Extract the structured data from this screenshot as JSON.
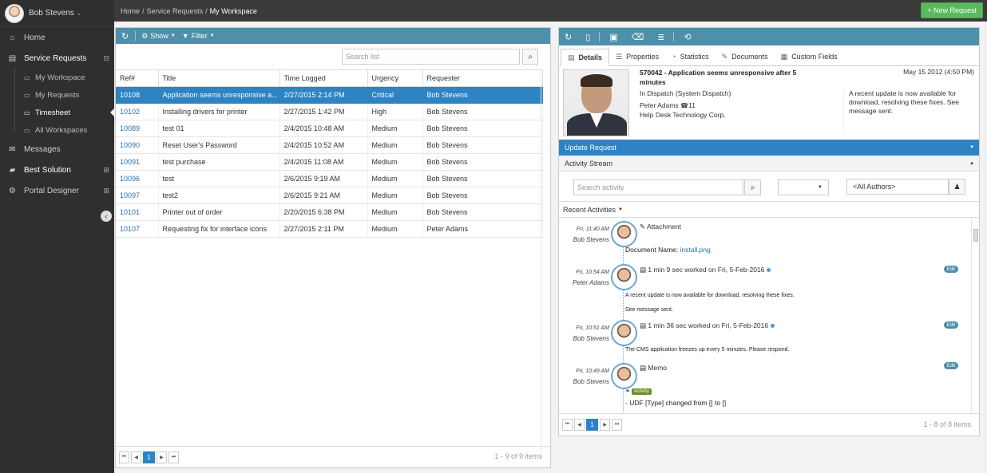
{
  "user": {
    "name": "Bob Stevens"
  },
  "sidebar": {
    "items": [
      {
        "label": "Home",
        "icon": "home-icon"
      },
      {
        "label": "Service Requests",
        "icon": "document-icon"
      },
      {
        "label": "Messages",
        "icon": "envelope-icon"
      },
      {
        "label": "Best Solution",
        "icon": "book-icon"
      },
      {
        "label": "Portal Designer",
        "icon": "gears-icon"
      }
    ],
    "subitems": [
      "My Workspace",
      "My Requests",
      "Timesheet",
      "All Workspaces"
    ]
  },
  "breadcrumb": {
    "home": "Home",
    "section": "Service Requests",
    "current": "My Workspace"
  },
  "new_request_label": "+ New Request",
  "list": {
    "toolbar": {
      "show": "Show",
      "filter": "Filter"
    },
    "search_placeholder": "Search list",
    "columns": [
      "Ref#",
      "Title",
      "Time Logged",
      "Urgency",
      "Requester"
    ],
    "rows": [
      [
        "10108",
        "Application seems unresponsive a...",
        "2/27/2015 2:14 PM",
        "Critical",
        "Bob Stevens"
      ],
      [
        "10102",
        "Installing drivers for printer",
        "2/27/2015 1:42 PM",
        "High",
        "Bob Stevens"
      ],
      [
        "10089",
        "test 01",
        "2/4/2015 10:48 AM",
        "Medium",
        "Bob Stevens"
      ],
      [
        "10090",
        "Reset User's Password",
        "2/4/2015 10:52 AM",
        "Medium",
        "Bob Stevens"
      ],
      [
        "10091",
        "test purchase",
        "2/4/2015 11:08 AM",
        "Medium",
        "Bob Stevens"
      ],
      [
        "10096",
        "test",
        "2/6/2015 9:19 AM",
        "Medium",
        "Bob Stevens"
      ],
      [
        "10097",
        "test2",
        "2/6/2015 9:21 AM",
        "Medium",
        "Bob Stevens"
      ],
      [
        "10101",
        "Printer out of order",
        "2/20/2015 6:38 PM",
        "Medium",
        "Bob Stevens"
      ],
      [
        "10107",
        "Requesting fix for interface icons",
        "2/27/2015 2:11 PM",
        "Medium",
        "Peter Adams"
      ]
    ],
    "page": "1",
    "pager_info": "1 - 9 of 9 items"
  },
  "detail": {
    "tabs": [
      "Details",
      "Properties",
      "Statistics",
      "Documents",
      "Custom Fields"
    ],
    "title": "570042 - Application seems unresponsive after 5 minutes",
    "date": "May 15 2012 (4:50 PM)",
    "status": "In Dispatch (System Dispatch)",
    "person": "Peter Adams",
    "person_count": "11",
    "company": "Help Desk Technology Corp.",
    "note": "A recent update is now available for download, resolving these fixes. See message sent.",
    "update_label": "Update Request",
    "stream_label": "Activity Stream",
    "search_activity_placeholder": "Search activity",
    "authors_value": "<All Authors>",
    "recent_label": "Recent Activities",
    "activities": [
      {
        "time": "Fri, 11:40 AM",
        "user": "Bob Stevens",
        "title": "Attachment",
        "body1": "Document Name: ",
        "link": "install.png"
      },
      {
        "time": "Fri, 10:54 AM",
        "user": "Peter Adams",
        "title": "1 min 9 sec worked on Fri, 5-Feb-2016",
        "body1": "A recent update is now available for download, resolving these fixes.",
        "body2": "See message sent.",
        "edit": "Edit"
      },
      {
        "time": "Fri, 10:51 AM",
        "user": "Bob Stevens",
        "title": "1 min 36 sec worked on Fri, 5-Feb-2016",
        "body1": "The CMS application freezes up every 5 minutes.  Please respond.",
        "edit": "Edit"
      },
      {
        "time": "Fri, 10:49 AM",
        "user": "Bob Stevens",
        "title": "Memo",
        "badge": "Activity",
        "body1": "- UDF [Type] changed from [] to []",
        "edit": "Edit"
      }
    ],
    "page": "1",
    "pager_info": "1 - 8 of 8 items"
  }
}
